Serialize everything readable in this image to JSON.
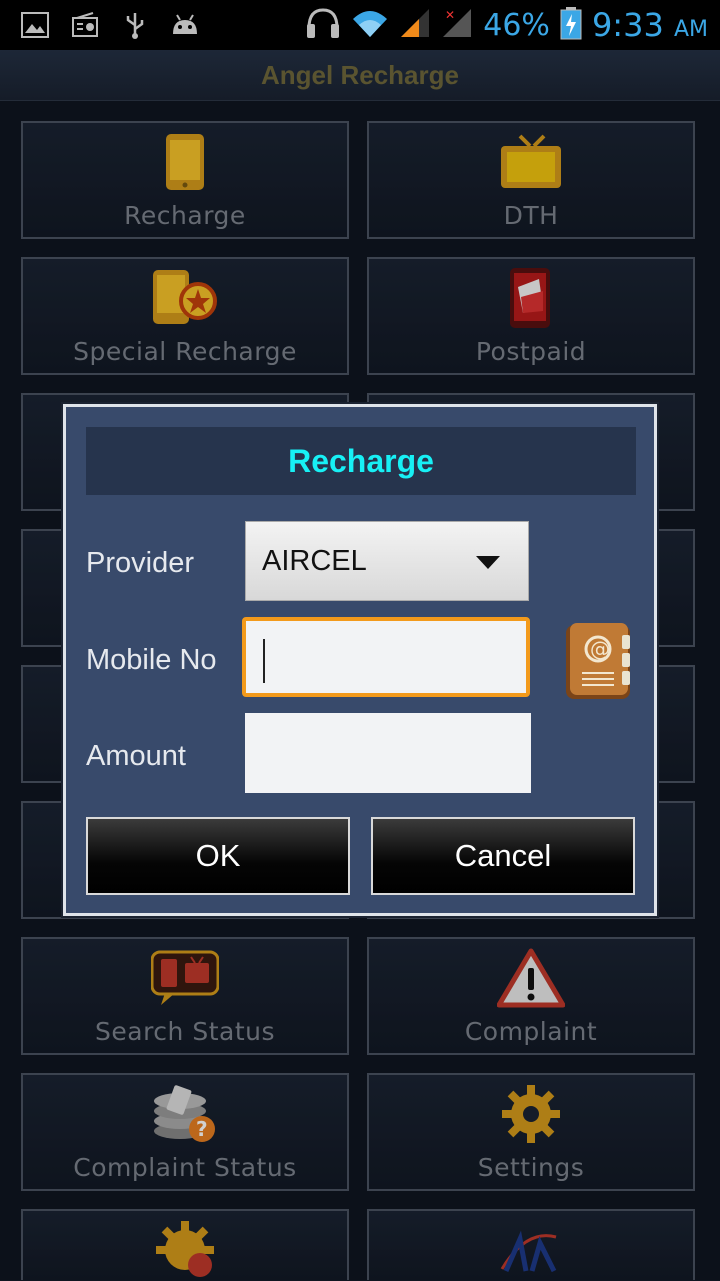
{
  "status_bar": {
    "battery": "46%",
    "time": "9:33",
    "ampm": "AM"
  },
  "app": {
    "title": "Angel Recharge"
  },
  "grid": {
    "items": [
      {
        "label": "Recharge",
        "icon": "phone-icon"
      },
      {
        "label": "DTH",
        "icon": "tv-icon"
      },
      {
        "label": "Special Recharge",
        "icon": "special-recharge-icon"
      },
      {
        "label": "Postpaid",
        "icon": "postpaid-icon"
      },
      {
        "label": "Search Status",
        "icon": "search-status-icon"
      },
      {
        "label": "Complaint",
        "icon": "warning-icon"
      },
      {
        "label": "Complaint Status",
        "icon": "complaint-status-icon"
      },
      {
        "label": "Settings",
        "icon": "gear-icon"
      }
    ]
  },
  "dialog": {
    "title": "Recharge",
    "provider_label": "Provider",
    "provider_value": "AIRCEL",
    "mobile_label": "Mobile No",
    "mobile_value": "",
    "amount_label": "Amount",
    "amount_value": "",
    "ok_label": "OK",
    "cancel_label": "Cancel"
  },
  "colors": {
    "dialog_title": "#17f0f5",
    "focus_border": "#f39a1b",
    "status_text": "#3ba7e6"
  }
}
